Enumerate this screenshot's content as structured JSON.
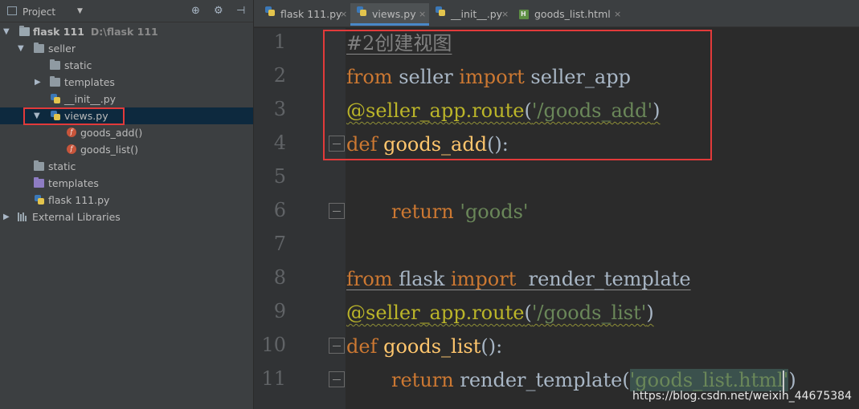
{
  "project_panel": {
    "title": "Project",
    "tree": [
      {
        "label": "flask 111",
        "hint": "D:\\flask 111"
      },
      {
        "label": "seller"
      },
      {
        "label": "static"
      },
      {
        "label": "templates"
      },
      {
        "label": "__init__.py"
      },
      {
        "label": "views.py"
      },
      {
        "label": "goods_add()"
      },
      {
        "label": "goods_list()"
      },
      {
        "label": "static"
      },
      {
        "label": "templates"
      },
      {
        "label": "flask 111.py"
      },
      {
        "label": "External Libraries"
      }
    ]
  },
  "tabs": [
    {
      "label": "flask 111.py",
      "active": false
    },
    {
      "label": "views.py",
      "active": true
    },
    {
      "label": "__init__.py",
      "active": false
    },
    {
      "label": "goods_list.html",
      "active": false
    }
  ],
  "editor": {
    "line_numbers": [
      "1",
      "2",
      "3",
      "4",
      "5",
      "6",
      "7",
      "8",
      "9",
      "10",
      "11"
    ],
    "code": {
      "l1_comment": "#2创建视图",
      "l2_from": "from",
      "l2_module": " seller ",
      "l2_import": "import",
      "l2_name": " seller_app",
      "l3_decorator": "@seller_app.route",
      "l3_open": "(",
      "l3_str": "'/goods_add'",
      "l3_close": ")",
      "l4_def": "def",
      "l4_name": " goods_add",
      "l4_tail": "():",
      "l6_return": "return",
      "l6_str": " 'goods'",
      "l8_from": "from",
      "l8_module": " flask ",
      "l8_import": "import",
      "l8_name": "  render_template",
      "l9_decorator": "@seller_app.route",
      "l9_open": "(",
      "l9_str": "'/goods_list'",
      "l9_close": ")",
      "l10_def": "def",
      "l10_name": " goods_list",
      "l10_tail": "():",
      "l11_return": "return",
      "l11_call": " render_template(",
      "l11_str_a": "'goods_list.html",
      "l11_str_b": "'",
      "l11_close": ")"
    }
  },
  "watermark": "https://blog.csdn.net/weixin_44675384",
  "colors": {
    "keyword": "#cc7832",
    "comment": "#808080",
    "decorator": "#bbb529",
    "string": "#6a8759",
    "function": "#ffc66d",
    "highlight_box": "#e23a3a"
  }
}
